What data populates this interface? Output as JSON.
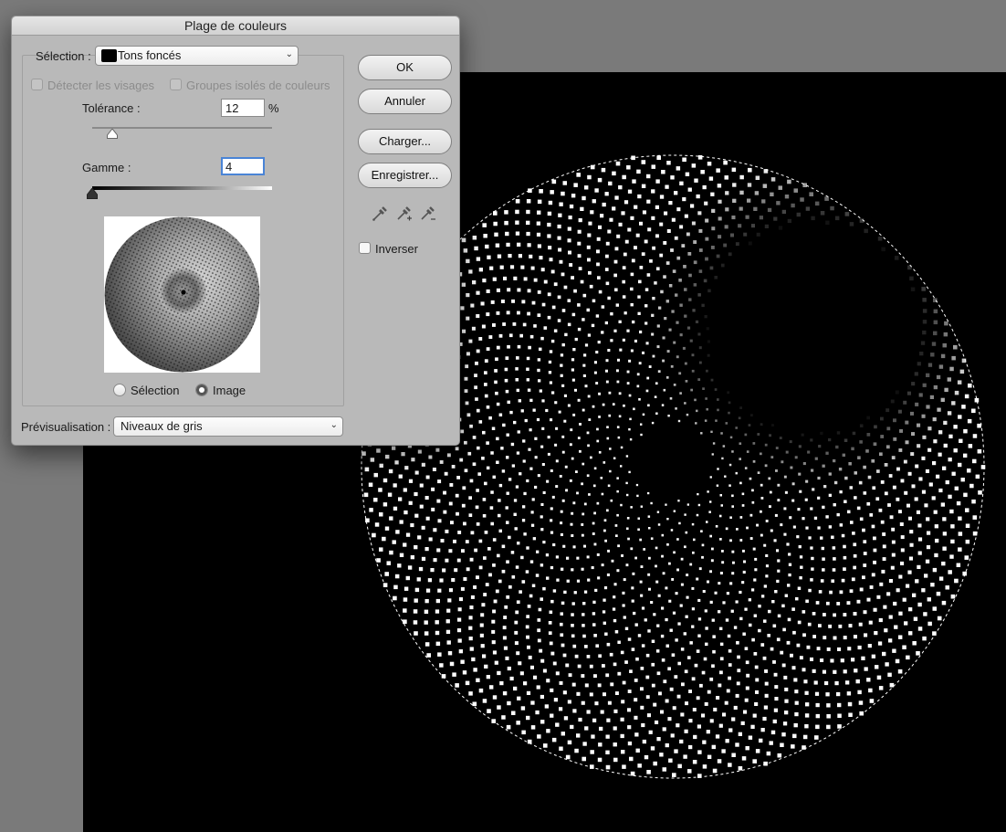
{
  "dialog": {
    "title": "Plage de couleurs",
    "selection_label": "Sélection :",
    "selection_value": "Tons foncés",
    "detect_faces_label": "Détecter les visages",
    "localized_clusters_label": "Groupes isolés de couleurs",
    "tolerance_label": "Tolérance :",
    "tolerance_value": "12",
    "tolerance_unit": "%",
    "range_label": "Gamme :",
    "range_value": "4",
    "view_selection_label": "Sélection",
    "view_image_label": "Image",
    "view_selected": "Image",
    "preview_label": "Prévisualisation :",
    "preview_value": "Niveaux de gris",
    "invert_label": "Inverser",
    "invert_checked": false
  },
  "buttons": {
    "ok": "OK",
    "cancel": "Annuler",
    "load": "Charger...",
    "save": "Enregistrer..."
  },
  "icons": {
    "eyedropper": "eyedropper-icon",
    "eyedropper_add": "eyedropper-plus-icon",
    "eyedropper_subtract": "eyedropper-minus-icon",
    "dropdown": "chevron-down-icon"
  },
  "colors": {
    "dialog_bg": "#b9b9b9",
    "canvas_bg": "#000000",
    "focus_ring": "#4a84d6"
  }
}
